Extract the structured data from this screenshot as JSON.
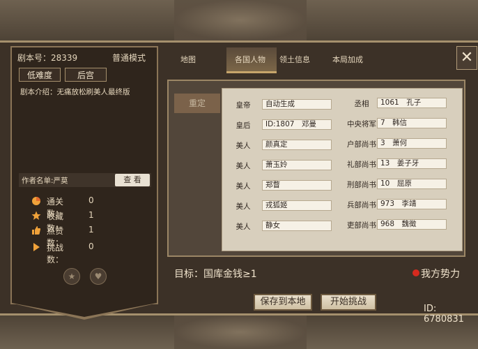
{
  "left_panel": {
    "script_no_label": "剧本号：",
    "script_no": "28339",
    "mode": "普通模式",
    "btn_difficulty": "低难度",
    "btn_palace": "后宫",
    "intro_label": "剧本介绍：",
    "intro_text": "无痛放松刷美人最终版",
    "author_label": "作者名单:严莫",
    "view_btn": "查 看",
    "stats": [
      {
        "label": "通关数：",
        "value": "0",
        "icon": "pie-chart-icon",
        "color": "#e36a2f"
      },
      {
        "label": "收藏数：",
        "value": "1",
        "icon": "star-icon",
        "color": "#f0a23a"
      },
      {
        "label": "点赞数：",
        "value": "1",
        "icon": "thumbs-up-icon",
        "color": "#f0a23a"
      },
      {
        "label": "挑战数：",
        "value": "0",
        "icon": "play-icon",
        "color": "#f0a23a"
      }
    ]
  },
  "tabs": [
    "地图",
    "各国人物",
    "领土信息",
    "本局加成"
  ],
  "active_tab_index": 1,
  "side_button": "重定",
  "characters_left": [
    {
      "role": "皇帝",
      "name": "自动生成"
    },
    {
      "role": "皇后",
      "name": "ID:1807　邓曼"
    },
    {
      "role": "美人",
      "name": "颜真定"
    },
    {
      "role": "美人",
      "name": "萧玉姈"
    },
    {
      "role": "美人",
      "name": "郑瞀"
    },
    {
      "role": "美人",
      "name": "戎狐姬"
    },
    {
      "role": "美人",
      "name": "静女"
    }
  ],
  "characters_right": [
    {
      "role": "丞相",
      "name": "1061　孔子"
    },
    {
      "role": "中央将军",
      "name": "7　韩信"
    },
    {
      "role": "户部尚书",
      "name": "3　萧何"
    },
    {
      "role": "礼部尚书",
      "name": "13　姜子牙"
    },
    {
      "role": "刑部尚书",
      "name": "10　屈原"
    },
    {
      "role": "兵部尚书",
      "name": "973　李靖"
    },
    {
      "role": "吏部尚书",
      "name": "968　魏徵"
    }
  ],
  "goal": "目标：国库金钱≥1",
  "our_side": "我方势力",
  "save_btn": "保存到本地",
  "start_btn": "开始挑战",
  "game_id": "ID: 6780831",
  "close_icon": "close-icon"
}
